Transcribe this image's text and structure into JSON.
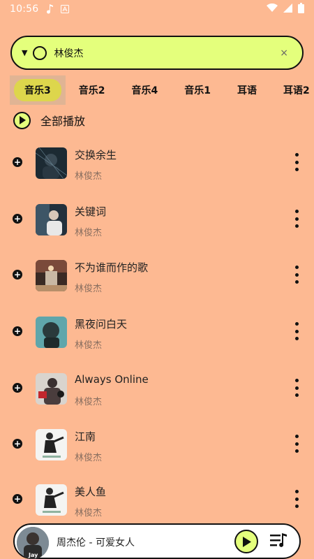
{
  "status": {
    "time": "10:56"
  },
  "search": {
    "query": "林俊杰",
    "dropdown_icon": "▼",
    "clear_icon": "×"
  },
  "tabs": [
    {
      "label": "音乐3",
      "active": true
    },
    {
      "label": "音乐2"
    },
    {
      "label": "音乐4"
    },
    {
      "label": "音乐1"
    },
    {
      "label": "耳语"
    },
    {
      "label": "耳语2"
    }
  ],
  "play_all": {
    "label": "全部播放"
  },
  "songs": [
    {
      "title": "交换余生",
      "artist": "林俊杰"
    },
    {
      "title": "关键词",
      "artist": "林俊杰"
    },
    {
      "title": "不为谁而作的歌",
      "artist": "林俊杰"
    },
    {
      "title": "黑夜问白天",
      "artist": "林俊杰"
    },
    {
      "title": "Always Online",
      "artist": "林俊杰"
    },
    {
      "title": "江南",
      "artist": "林俊杰"
    },
    {
      "title": "美人鱼",
      "artist": "林俊杰"
    }
  ],
  "player": {
    "now_playing": "周杰伦 - 可爱女人",
    "disc_text": "Jay"
  },
  "colors": {
    "background": "#FDB992",
    "accent": "#E4FF7C",
    "tab_highlight": "#DDD64C"
  }
}
